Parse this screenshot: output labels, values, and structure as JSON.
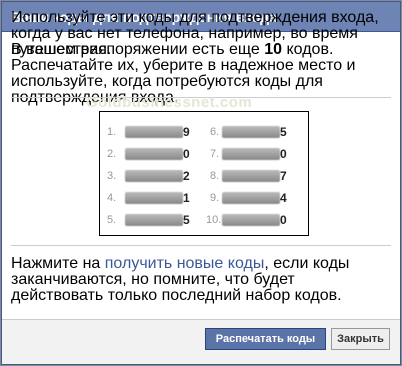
{
  "dialog": {
    "title": "Ваши коды для подтверждения входа",
    "intro": "Используйте эти коды для подтверждения входа, когда у вас нет телефона, например, во время путешествия.",
    "remaining_prefix": "В вашем распоряжении есть еще ",
    "remaining_count": "10",
    "remaining_suffix": " кодов. Распечатайте их, уберите в надежное место и используйте, когда потребуются коды для подтверждения входа.",
    "watermark": "Goldbusinessnet.com",
    "footer_prefix": "Нажмите на ",
    "footer_link": "получить новые коды",
    "footer_suffix": ", если коды заканчиваются, но помните, что будет действовать только последний набор кодов."
  },
  "codes": [
    {
      "num": "1.",
      "last": "9"
    },
    {
      "num": "2.",
      "last": "0"
    },
    {
      "num": "3.",
      "last": "2"
    },
    {
      "num": "4.",
      "last": "1"
    },
    {
      "num": "5.",
      "last": "5"
    },
    {
      "num": "6.",
      "last": "5"
    },
    {
      "num": "7.",
      "last": "0"
    },
    {
      "num": "8.",
      "last": "7"
    },
    {
      "num": "9.",
      "last": "4"
    },
    {
      "num": "10.",
      "last": "0"
    }
  ],
  "buttons": {
    "print": "Распечатать коды",
    "close": "Закрыть"
  },
  "colors": {
    "titlebar": "#6d84b4",
    "primary_button": "#5b74a8",
    "link": "#3b5998"
  }
}
